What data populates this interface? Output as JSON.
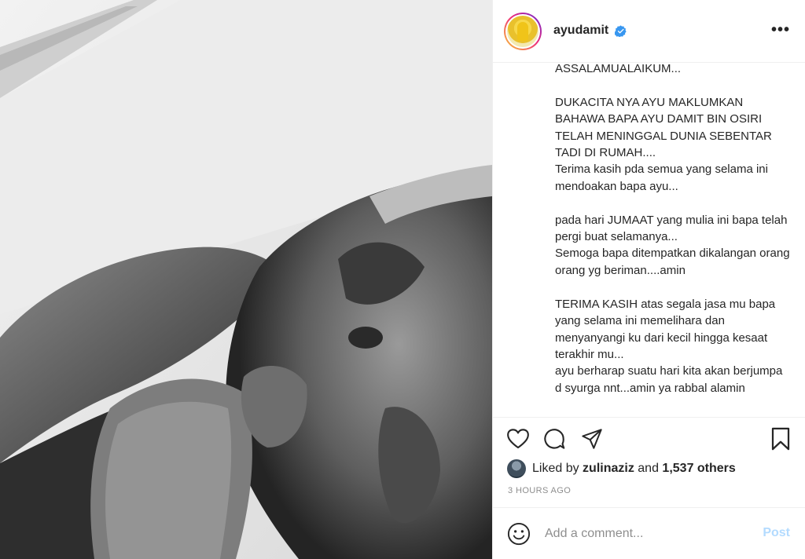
{
  "post": {
    "username": "ayudamit",
    "more_label": "•••",
    "caption": "ASSALAMUALAIKUM...\n\nDUKACITA NYA AYU MAKLUMKAN BAHAWA BAPA AYU DAMIT BIN OSIRI TELAH MENINGGAL DUNIA SEBENTAR TADI DI RUMAH....\nTerima kasih pda semua yang selama ini mendoakan bapa ayu...\n\npada hari JUMAAT yang mulia ini bapa telah pergi buat selamanya...\nSemoga bapa ditempatkan dikalangan orang orang yg beriman....amin\n\nTERIMA KASIH atas segala jasa mu bapa yang selama ini memelihara dan menyanyangi ku dari kecil hingga kesaat terakhir mu...\nayu berharap suatu hari kita akan berjumpa d syurga nnt...amin ya rabbal alamin",
    "likes": {
      "prefix": "Liked by ",
      "user": "zulinaziz",
      "middle": " and ",
      "others": "1,537 others"
    },
    "timestamp": "3 HOURS AGO",
    "comment": {
      "placeholder": "Add a comment...",
      "post_label": "Post"
    }
  },
  "icons": {
    "verified": "verified-badge-icon",
    "like": "heart-icon",
    "comment": "comment-icon",
    "share": "paper-plane-icon",
    "save": "bookmark-icon",
    "emoji": "smiley-icon"
  },
  "colors": {
    "verified_blue": "#3897f0",
    "post_button_disabled": "#b3dbff",
    "muted_text": "#8e8e8e"
  }
}
